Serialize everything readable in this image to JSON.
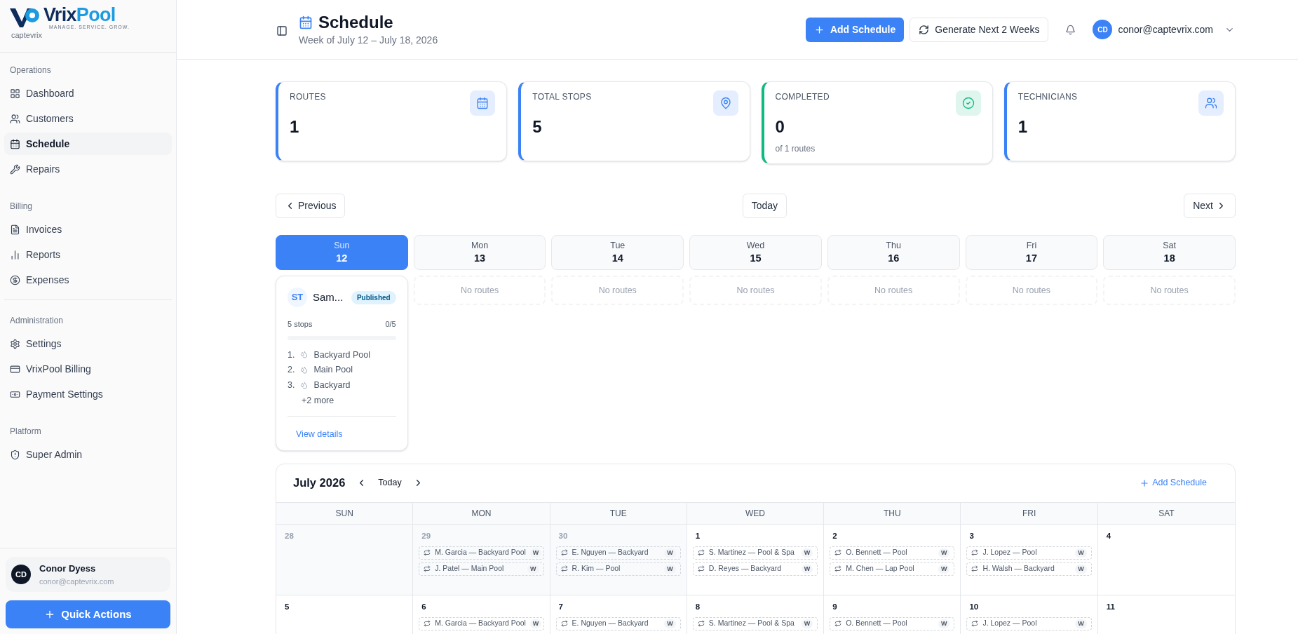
{
  "brand": {
    "name_part_1": "Vrix",
    "name_part_2": "Pool",
    "tagline": "MANAGE. SERVICE. GROW.",
    "org": "captevrix"
  },
  "sidebar": {
    "sections": [
      {
        "title": "Operations",
        "divider": false,
        "items": [
          {
            "label": "Dashboard",
            "selected": false
          },
          {
            "label": "Customers",
            "selected": false
          },
          {
            "label": "Schedule",
            "selected": true
          },
          {
            "label": "Repairs",
            "selected": false
          }
        ]
      },
      {
        "title": "Billing",
        "divider": false,
        "items": [
          {
            "label": "Invoices",
            "selected": false
          },
          {
            "label": "Reports",
            "selected": false
          },
          {
            "label": "Expenses",
            "selected": false
          }
        ]
      },
      {
        "title": "Administration",
        "divider": true,
        "items": [
          {
            "label": "Settings",
            "selected": false
          },
          {
            "label": "VrixPool Billing",
            "selected": false
          },
          {
            "label": "Payment Settings",
            "selected": false
          }
        ]
      },
      {
        "title": "Platform",
        "divider": false,
        "items": [
          {
            "label": "Super Admin",
            "selected": false
          }
        ]
      }
    ],
    "user": {
      "initials": "CD",
      "name": "Conor Dyess",
      "email": "conor@captevrix.com"
    },
    "quick_actions": "Quick Actions"
  },
  "header": {
    "title": "Schedule",
    "subtitle": "Week of July 12 – July 18, 2026",
    "add_button": "Add Schedule",
    "generate_button": "Generate Next 2 Weeks",
    "user_initials": "CD",
    "user_email": "conor@captevrix.com"
  },
  "stats": [
    {
      "label": "ROUTES",
      "value": "1",
      "color": "#3b82f6"
    },
    {
      "label": "TOTAL STOPS",
      "value": "5",
      "color": "#3b82f6"
    },
    {
      "label": "COMPLETED",
      "value": "0",
      "note": "of 1 routes",
      "color": "#10b981"
    },
    {
      "label": "TECHNICIANS",
      "value": "1",
      "color": "#3b82f6"
    }
  ],
  "week_nav": {
    "previous": "Previous",
    "today": "Today",
    "next": "Next"
  },
  "week_days": [
    {
      "day": "Sun",
      "date": "12",
      "selected": true,
      "routes": [
        {
          "initials": "ST",
          "name": "Sam...",
          "status": "Published",
          "stops": "5 stops",
          "progress": "0/5",
          "level": 0,
          "stop_list": [
            {
              "number": "1.",
              "name": "Backyard Pool"
            },
            {
              "number": "2.",
              "name": "Main Pool"
            },
            {
              "number": "3.",
              "name": "Backyard"
            }
          ],
          "more": "+2 more",
          "link": "View details"
        }
      ]
    },
    {
      "day": "Mon",
      "date": "13",
      "selected": false,
      "empty": "No routes"
    },
    {
      "day": "Tue",
      "date": "14",
      "selected": false,
      "empty": "No routes"
    },
    {
      "day": "Wed",
      "date": "15",
      "selected": false,
      "empty": "No routes"
    },
    {
      "day": "Thu",
      "date": "16",
      "selected": false,
      "empty": "No routes"
    },
    {
      "day": "Fri",
      "date": "17",
      "selected": false,
      "empty": "No routes"
    },
    {
      "day": "Sat",
      "date": "18",
      "selected": false,
      "empty": "No routes"
    }
  ],
  "month": {
    "title": "July 2026",
    "today": "Today",
    "add": "Add Schedule",
    "weekdays": [
      "SUN",
      "MON",
      "TUE",
      "WED",
      "THU",
      "FRI",
      "SAT"
    ],
    "weeks": [
      [
        {
          "date": "28",
          "outside": true
        },
        {
          "date": "29",
          "outside": true,
          "events": [
            {
              "label": "M. Garcia — Backyard Pool",
              "badge": "W"
            },
            {
              "label": "J. Patel — Main Pool",
              "badge": "W"
            }
          ]
        },
        {
          "date": "30",
          "outside": true,
          "events": [
            {
              "label": "E. Nguyen — Backyard",
              "badge": "W"
            },
            {
              "label": "R. Kim — Pool",
              "badge": "W"
            }
          ]
        },
        {
          "date": "1",
          "outside": false,
          "events": [
            {
              "label": "S. Martinez — Pool & Spa",
              "badge": "W"
            },
            {
              "label": "D. Reyes — Backyard",
              "badge": "W"
            }
          ]
        },
        {
          "date": "2",
          "outside": false,
          "events": [
            {
              "label": "O. Bennett — Pool",
              "badge": "W"
            },
            {
              "label": "M. Chen — Lap Pool",
              "badge": "W"
            }
          ]
        },
        {
          "date": "3",
          "outside": false,
          "events": [
            {
              "label": "J. Lopez — Pool",
              "badge": "W"
            },
            {
              "label": "H. Walsh — Backyard",
              "badge": "W"
            }
          ]
        },
        {
          "date": "4",
          "outside": false
        }
      ],
      [
        {
          "date": "5",
          "outside": false
        },
        {
          "date": "6",
          "outside": false,
          "events": [
            {
              "label": "M. Garcia — Backyard Pool",
              "badge": "W"
            }
          ]
        },
        {
          "date": "7",
          "outside": false,
          "events": [
            {
              "label": "E. Nguyen — Backyard",
              "badge": "W"
            }
          ]
        },
        {
          "date": "8",
          "outside": false,
          "events": [
            {
              "label": "S. Martinez — Pool & Spa",
              "badge": "W"
            }
          ]
        },
        {
          "date": "9",
          "outside": false,
          "events": [
            {
              "label": "O. Bennett — Pool",
              "badge": "W"
            }
          ]
        },
        {
          "date": "10",
          "outside": false,
          "events": [
            {
              "label": "J. Lopez — Pool",
              "badge": "W"
            }
          ]
        },
        {
          "date": "11",
          "outside": false
        }
      ]
    ]
  }
}
